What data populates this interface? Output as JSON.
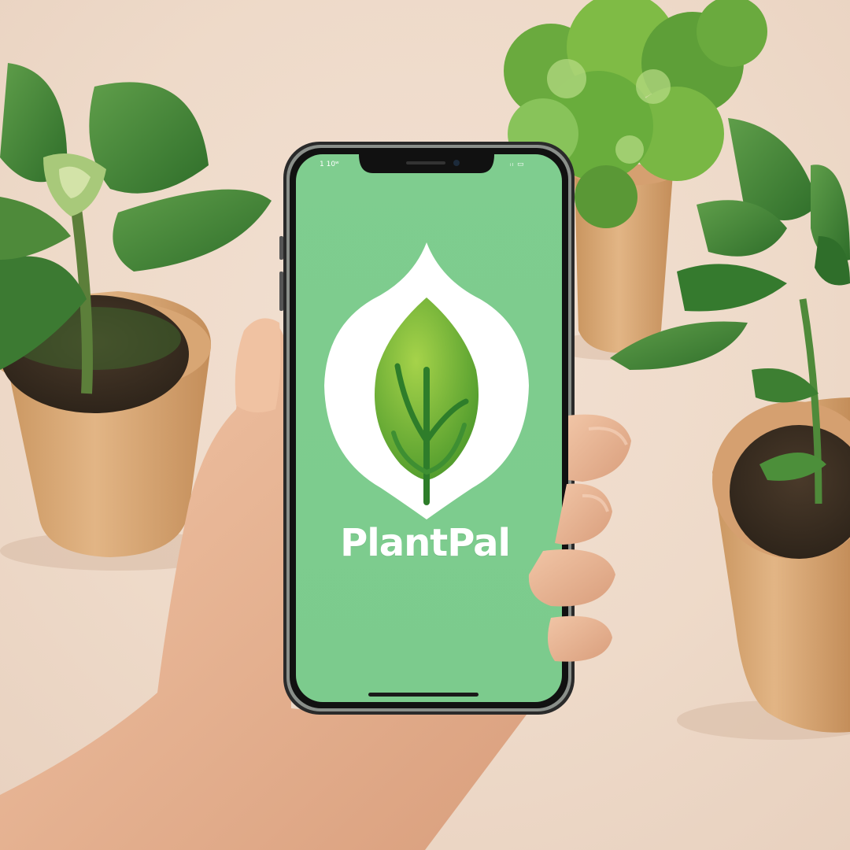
{
  "app": {
    "name": "PlantPal",
    "status_time": "1 10ʷ",
    "status_icons": "ᵢₗ ▭"
  },
  "icons": {
    "logo": "leaf-drop-icon"
  },
  "colors": {
    "screen_green": "#7cca8e",
    "leaf_green": "#6fb43a",
    "background": "#efd9c8",
    "pot": "#d6a679"
  }
}
